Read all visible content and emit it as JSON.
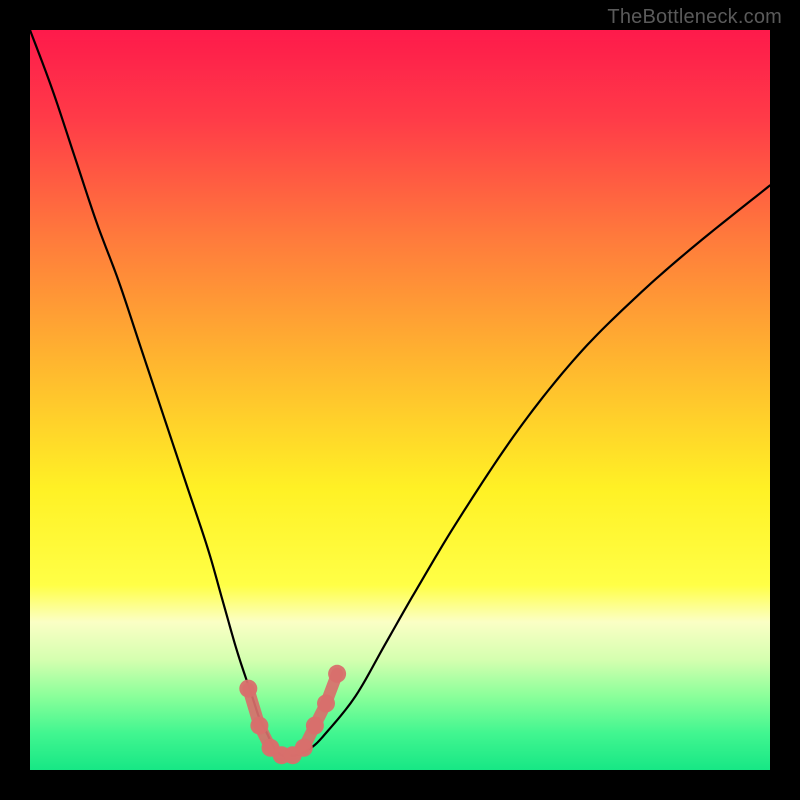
{
  "watermark": {
    "text": "TheBottleneck.com"
  },
  "chart_data": {
    "type": "line",
    "title": "",
    "xlabel": "",
    "ylabel": "",
    "xlim": [
      0,
      100
    ],
    "ylim": [
      0,
      100
    ],
    "grid": false,
    "legend": "none",
    "background_gradient": {
      "stops": [
        {
          "pct": 0,
          "color": "#fe1a4b"
        },
        {
          "pct": 12,
          "color": "#ff3b48"
        },
        {
          "pct": 28,
          "color": "#ff7a3c"
        },
        {
          "pct": 45,
          "color": "#ffb62f"
        },
        {
          "pct": 62,
          "color": "#fff125"
        },
        {
          "pct": 75,
          "color": "#ffff46"
        },
        {
          "pct": 80,
          "color": "#fbffc5"
        },
        {
          "pct": 85,
          "color": "#d6ffb0"
        },
        {
          "pct": 90,
          "color": "#8bff9a"
        },
        {
          "pct": 95,
          "color": "#42f690"
        },
        {
          "pct": 100,
          "color": "#17e785"
        }
      ]
    },
    "series": [
      {
        "name": "bottleneck-curve",
        "color": "#000000",
        "x": [
          0,
          3,
          6,
          9,
          12,
          15,
          18,
          21,
          24,
          26,
          28,
          30,
          31,
          32,
          33,
          34,
          35,
          36,
          38,
          40,
          44,
          48,
          52,
          58,
          66,
          74,
          82,
          90,
          100
        ],
        "y": [
          100,
          92,
          83,
          74,
          66,
          57,
          48,
          39,
          30,
          23,
          16,
          10,
          7,
          5,
          3,
          2,
          2,
          2,
          3,
          5,
          10,
          17,
          24,
          34,
          46,
          56,
          64,
          71,
          79
        ]
      },
      {
        "name": "highlight-markers",
        "color": "#d86f6b",
        "type": "scatter",
        "x": [
          29.5,
          31,
          32.5,
          34,
          35.5,
          37,
          38.5,
          40,
          41.5
        ],
        "y": [
          11,
          6,
          3,
          2,
          2,
          3,
          6,
          9,
          13
        ]
      }
    ],
    "annotations": []
  }
}
